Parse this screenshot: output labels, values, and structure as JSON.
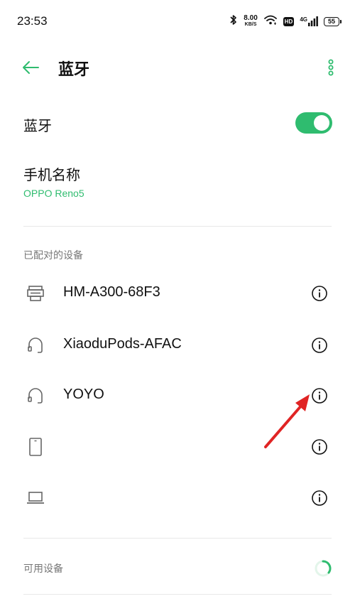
{
  "status_bar": {
    "time": "23:53",
    "net_speed_value": "8.00",
    "net_speed_unit": "KB/S",
    "hd_badge": "HD",
    "network_type": "4G",
    "battery_level": "55",
    "icons": [
      "bluetooth-icon",
      "wifi-icon",
      "hd-icon",
      "cellular-signal-icon",
      "battery-icon"
    ]
  },
  "header": {
    "title": "蓝牙",
    "back_icon": "back-arrow-icon",
    "more_icon": "more-vertical-icon"
  },
  "bluetooth": {
    "label": "蓝牙",
    "enabled": true
  },
  "phone_name": {
    "label": "手机名称",
    "value": "OPPO Reno5"
  },
  "paired_devices": {
    "section_title": "已配对的设备",
    "items": [
      {
        "name": "HM-A300-68F3",
        "icon": "printer-icon"
      },
      {
        "name": "XiaoduPods-AFAC",
        "icon": "headphones-icon"
      },
      {
        "name": "YOYO",
        "icon": "headphones-icon"
      },
      {
        "name": "",
        "icon": "phone-icon"
      },
      {
        "name": "",
        "icon": "laptop-icon"
      }
    ]
  },
  "available_devices": {
    "section_title": "可用设备",
    "scanning_icon": "loading-spinner-icon"
  },
  "colors": {
    "accent": "#2fbc6f",
    "annotation_arrow": "#e02424",
    "divider": "#e8e8e8",
    "secondary_text": "#777777"
  }
}
